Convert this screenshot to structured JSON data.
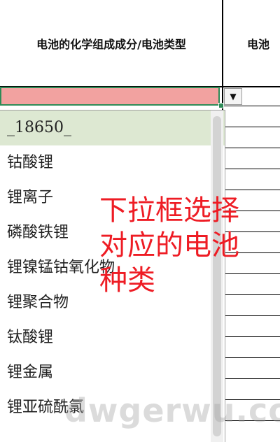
{
  "header": {
    "col_a": "电池的化学组成成分/电池类型",
    "col_b": "电池"
  },
  "dropdown": {
    "arrow_icon": "chevron-down-icon",
    "options": [
      "_18650_",
      "钴酸锂",
      "锂离子",
      "磷酸铁锂",
      "锂镍锰钴氧化物",
      "锂聚合物",
      "钛酸锂",
      "锂金属",
      "锂亚硫酰氯"
    ],
    "selected_option": "_18650_"
  },
  "annotation": {
    "text": "下拉框选择\n对应的电池\n种类"
  },
  "watermark": {
    "text": "dwgerwu.com"
  },
  "colors": {
    "active_cell_fill": "#f2a2a0",
    "active_cell_border": "#2e8b57",
    "selected_option_bg": "#dde8d2",
    "annotation_text": "#ee1c24"
  }
}
